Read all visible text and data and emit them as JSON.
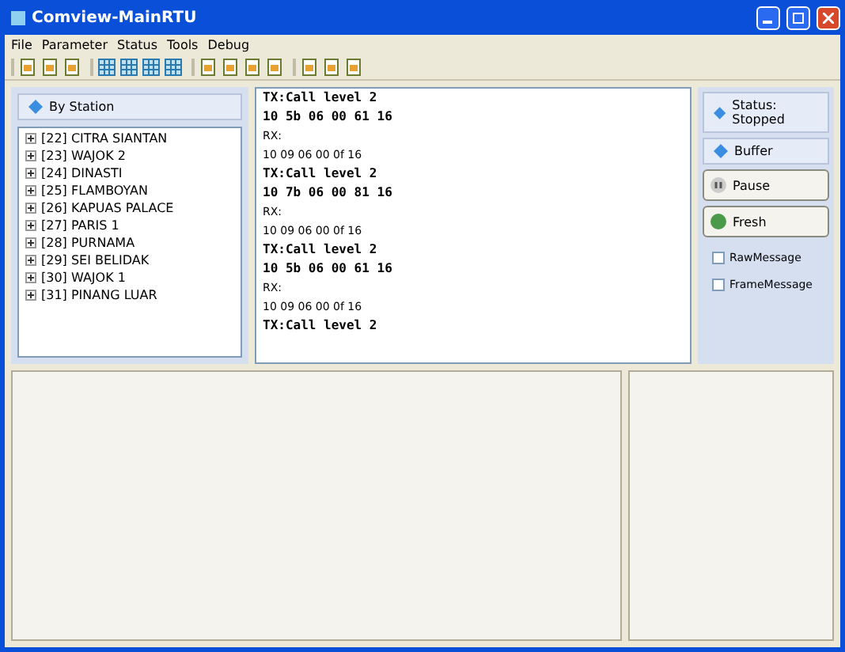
{
  "window": {
    "title": "Comview-MainRTU"
  },
  "menu": [
    "File",
    "Parameter",
    "Status",
    "Tools",
    "Debug"
  ],
  "toolbar": {
    "groups": [
      [
        {
          "kind": "document"
        },
        {
          "kind": "document"
        },
        {
          "kind": "document"
        }
      ],
      [
        {
          "kind": "grid"
        },
        {
          "kind": "grid"
        },
        {
          "kind": "grid"
        },
        {
          "kind": "grid"
        }
      ],
      [
        {
          "kind": "document"
        },
        {
          "kind": "document"
        },
        {
          "kind": "document"
        },
        {
          "kind": "document"
        }
      ],
      [
        {
          "kind": "document"
        },
        {
          "kind": "document"
        },
        {
          "kind": "document"
        }
      ]
    ]
  },
  "station_panel": {
    "header": "By Station",
    "items": [
      {
        "label": "[22] CITRA SIANTAN",
        "expanded": false
      },
      {
        "label": "[23] WAJOK 2",
        "expanded": false
      },
      {
        "label": "[24] DINASTI",
        "expanded": false
      },
      {
        "label": "[25] FLAMBOYAN",
        "expanded": false
      },
      {
        "label": "[26] KAPUAS PALACE",
        "expanded": false
      },
      {
        "label": "[27] PARIS 1",
        "expanded": false
      },
      {
        "label": "[28] PURNAMA",
        "expanded": false
      },
      {
        "label": "[29] SEI BELIDAK",
        "expanded": false
      },
      {
        "label": "[30] WAJOK 1",
        "expanded": false
      },
      {
        "label": "[31] PINANG LUAR",
        "expanded": false
      }
    ]
  },
  "log": [
    {
      "kind": "tx",
      "text": "TX:Call level 2"
    },
    {
      "kind": "txhex",
      "text": "10 5b 06 00 61 16"
    },
    {
      "kind": "rx",
      "text": "RX:"
    },
    {
      "kind": "rxhex",
      "text": "10 09 06 00 0f 16"
    },
    {
      "kind": "tx",
      "text": "TX:Call level 2"
    },
    {
      "kind": "txhex",
      "text": "10 7b 06 00 81 16"
    },
    {
      "kind": "rx",
      "text": "RX:"
    },
    {
      "kind": "rxhex",
      "text": "10 09 06 00 0f 16"
    },
    {
      "kind": "tx",
      "text": "TX:Call level 2"
    },
    {
      "kind": "txhex",
      "text": "10 5b 06 00 61 16"
    },
    {
      "kind": "rx",
      "text": "RX:"
    },
    {
      "kind": "rxhex",
      "text": "10 09 06 00 0f 16"
    },
    {
      "kind": "tx",
      "text": "TX:Call level 2"
    }
  ],
  "status_panel": {
    "status": "Status: Stopped",
    "buffer": "Buffer",
    "pause": "Pause",
    "fresh": "Fresh",
    "options": [
      {
        "label": "RawMessage",
        "checked": false
      },
      {
        "label": "FrameMessage",
        "checked": false
      }
    ]
  }
}
